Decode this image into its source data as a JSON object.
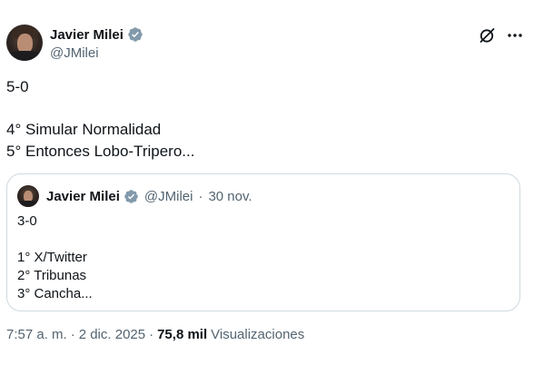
{
  "author": {
    "display_name": "Javier Milei",
    "handle": "@JMilei",
    "verified": true
  },
  "icons": {
    "verified": "verified-badge-icon",
    "grok": "grok-icon",
    "more": "more-options-icon"
  },
  "colors": {
    "verified_badge": "#829aab",
    "secondary_text": "#536471",
    "border": "#cfd9de"
  },
  "tweet": {
    "text": "5-0\n\n4° Simular Normalidad\n5° Entonces Lobo-Tripero..."
  },
  "quoted_tweet": {
    "display_name": "Javier Milei",
    "handle": "@JMilei",
    "date": "30 nov.",
    "meta_separator": "·",
    "text": "3-0\n\n1° X/Twitter\n2° Tribunas\n3° Cancha..."
  },
  "footer": {
    "time": "7:57 a. m.",
    "separator": "·",
    "date": "2 dic. 2025",
    "views_count": "75,8 mil",
    "views_label": "Visualizaciones"
  }
}
